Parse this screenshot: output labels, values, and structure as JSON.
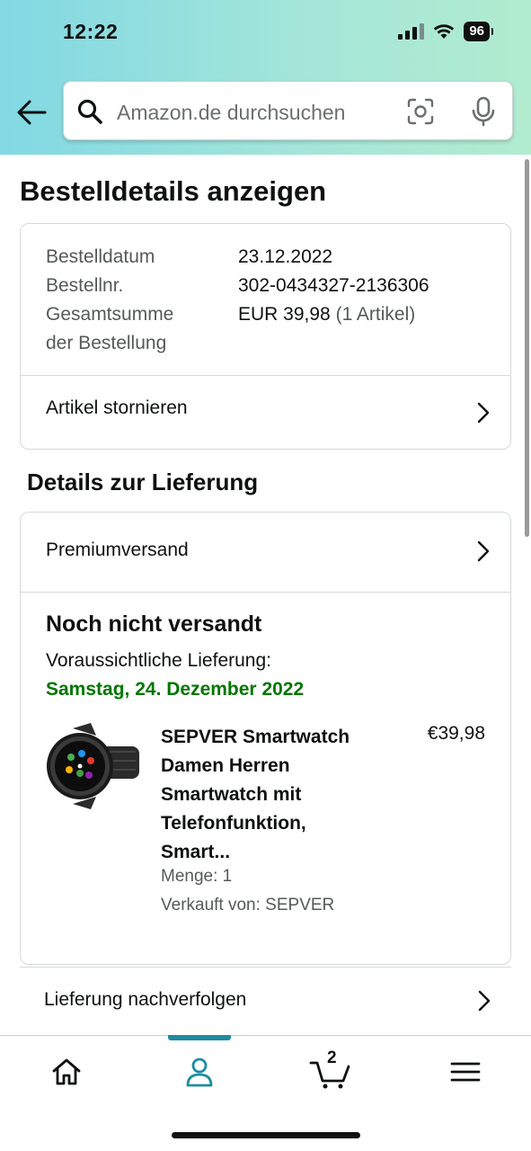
{
  "status_bar": {
    "time": "12:22",
    "battery": "96"
  },
  "search": {
    "placeholder": "Amazon.de durchsuchen"
  },
  "page": {
    "title": "Bestelldetails anzeigen"
  },
  "order_summary": {
    "order_date_label": "Bestelldatum",
    "order_date": "23.12.2022",
    "order_number_label": "Bestellnr.",
    "order_number": "302-0434327-2136306",
    "total_label_line1": "Gesamtsumme",
    "total_label_line2": "der Bestellung",
    "total_value": "EUR 39,98",
    "total_items": "(1 Artikel)",
    "cancel_label": "Artikel stornieren"
  },
  "delivery": {
    "section_title": "Details zur Lieferung",
    "shipping_method": "Premiumversand",
    "status": "Noch nicht versandt",
    "eta_label": "Voraussichtliche Lieferung:",
    "eta_date": "Samstag, 24. Dezember 2022",
    "eta_color": "#007600",
    "product": {
      "title_lines": [
        "SEPVER Smartwatch",
        "Damen Herren",
        "Smartwatch mit",
        "Telefonfunktion,",
        "Smart..."
      ],
      "price": "€39,98",
      "quantity": "Menge: 1",
      "seller": "Verkauft von: SEPVER"
    },
    "track_label": "Lieferung nachverfolgen"
  },
  "bottom_nav": {
    "items": [
      "home-icon",
      "account-icon",
      "cart-icon",
      "menu-icon"
    ],
    "cart_count": "2",
    "active": "account",
    "accent_color": "#1f8c9e"
  }
}
